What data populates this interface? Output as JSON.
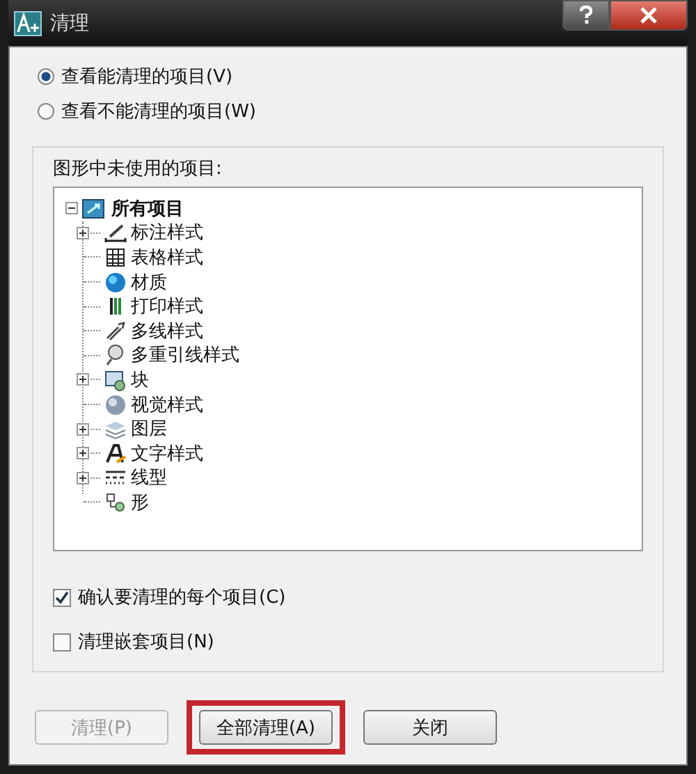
{
  "window": {
    "title": "清理"
  },
  "view_options": [
    {
      "label": "查看能清理的项目(V)",
      "selected": true
    },
    {
      "label": "查看不能清理的项目(W)",
      "selected": false
    }
  ],
  "tree": {
    "label": "图形中未使用的项目:",
    "root": {
      "label": "所有项目",
      "expanded": true,
      "children": [
        {
          "label": "标注样式",
          "kind": "dimension",
          "expandable": true
        },
        {
          "label": "表格样式",
          "kind": "table",
          "expandable": false
        },
        {
          "label": "材质",
          "kind": "material",
          "expandable": false
        },
        {
          "label": "打印样式",
          "kind": "plot",
          "expandable": false
        },
        {
          "label": "多线样式",
          "kind": "mline",
          "expandable": false
        },
        {
          "label": "多重引线样式",
          "kind": "mleader",
          "expandable": false
        },
        {
          "label": "块",
          "kind": "block",
          "expandable": true
        },
        {
          "label": "视觉样式",
          "kind": "visual",
          "expandable": false
        },
        {
          "label": "图层",
          "kind": "layer",
          "expandable": true
        },
        {
          "label": "文字样式",
          "kind": "text",
          "expandable": true
        },
        {
          "label": "线型",
          "kind": "linetype",
          "expandable": true
        },
        {
          "label": "形",
          "kind": "shape",
          "expandable": false
        }
      ]
    }
  },
  "checkboxes": [
    {
      "label": "确认要清理的每个项目(C)",
      "checked": true
    },
    {
      "label": "清理嵌套项目(N)",
      "checked": false
    }
  ],
  "buttons": [
    {
      "label": "清理(P)",
      "disabled": true,
      "highlighted": false
    },
    {
      "label": "全部清理(A)",
      "disabled": false,
      "highlighted": true
    },
    {
      "label": "关闭",
      "disabled": false,
      "highlighted": false
    }
  ]
}
